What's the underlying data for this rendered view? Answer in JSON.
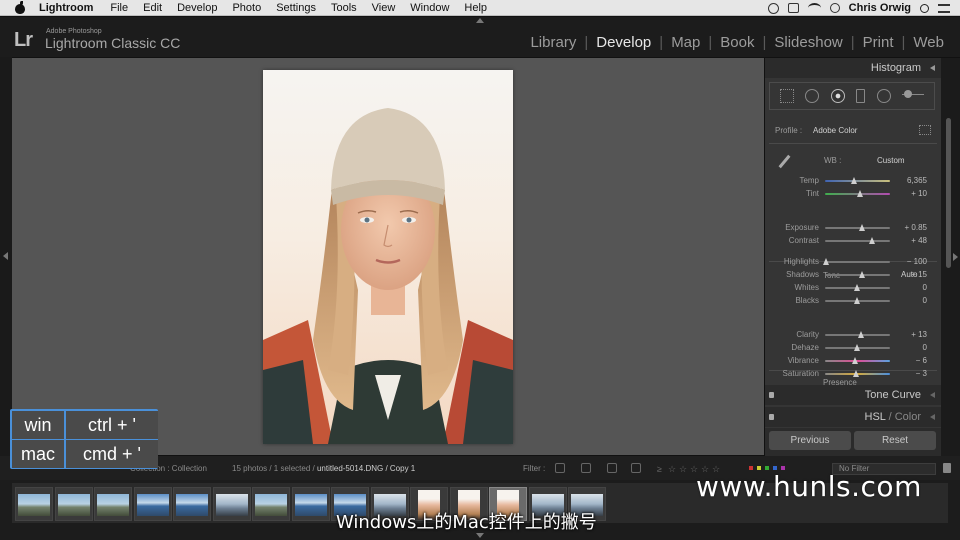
{
  "menubar": {
    "app": "Lightroom",
    "items": [
      "File",
      "Edit",
      "Develop",
      "Photo",
      "Settings",
      "Tools",
      "View",
      "Window",
      "Help"
    ],
    "user": "Chris Orwig"
  },
  "header": {
    "logo": "Lr",
    "brand_small": "Adobe Photoshop",
    "brand_title": "Lightroom Classic CC",
    "modules": [
      {
        "label": "Library"
      },
      {
        "label": "Develop"
      },
      {
        "label": "Map"
      },
      {
        "label": "Book"
      },
      {
        "label": "Slideshow"
      },
      {
        "label": "Print"
      },
      {
        "label": "Web"
      }
    ],
    "active_module": "Develop"
  },
  "right_panel": {
    "histogram": "Histogram",
    "tools": [
      "crop-overlay-icon",
      "spot-removal-icon",
      "red-eye-icon",
      "graduated-filter-icon",
      "radial-filter-icon",
      "adjustment-brush-icon"
    ],
    "profile_label": "Profile :",
    "profile_value": "Adobe Color",
    "wb_label": "WB :",
    "wb_value": "Custom",
    "tone_label": "Tone",
    "auto_label": "Auto",
    "presence_label": "Presence",
    "sliders": [
      {
        "label": "Temp",
        "value": "6,365",
        "pos": 0.45
      },
      {
        "label": "Tint",
        "value": "+ 10",
        "pos": 0.55
      },
      {
        "label": "Exposure",
        "value": "+ 0.85",
        "pos": 0.58
      },
      {
        "label": "Contrast",
        "value": "+ 48",
        "pos": 0.73
      },
      {
        "label": "Highlights",
        "value": "− 100",
        "pos": 0.02
      },
      {
        "label": "Shadows",
        "value": "+ 15",
        "pos": 0.57
      },
      {
        "label": "Whites",
        "value": "0",
        "pos": 0.5
      },
      {
        "label": "Blacks",
        "value": "0",
        "pos": 0.5
      },
      {
        "label": "Clarity",
        "value": "+ 13",
        "pos": 0.56
      },
      {
        "label": "Dehaze",
        "value": "0",
        "pos": 0.5
      },
      {
        "label": "Vibrance",
        "value": "− 6",
        "pos": 0.47
      },
      {
        "label": "Saturation",
        "value": "− 3",
        "pos": 0.48
      }
    ],
    "tone_curve": "Tone Curve",
    "hsl_a": "HSL",
    "hsl_sep": " / ",
    "hsl_b": "Color",
    "previous": "Previous",
    "reset": "Reset"
  },
  "filmbar": {
    "collection": "Collection : Collection",
    "count": "15 photos / 1 selected /",
    "filename": "untitled-5014.DNG / Copy 1",
    "filter_label": "Filter :",
    "no_filter": "No Filter"
  },
  "filmstrip": {
    "thumbs": [
      "landscape",
      "landscape",
      "landscape",
      "landscape",
      "landscape",
      "landscape",
      "landscape",
      "landscape",
      "landscape",
      "landscape",
      "portrait",
      "portrait",
      "portrait",
      "landscape",
      "landscape"
    ],
    "selected_index": 12
  },
  "shortcut": {
    "rows": [
      {
        "key": "win",
        "val": "ctrl + '"
      },
      {
        "key": "mac",
        "val": "cmd + '"
      }
    ]
  },
  "watermark": "www.hunls.com",
  "subtitle": "Windows上的Mac控件上的撇号"
}
